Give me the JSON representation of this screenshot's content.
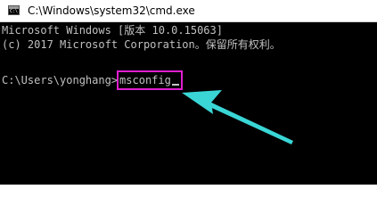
{
  "window": {
    "title": "C:\\Windows\\system32\\cmd.exe",
    "icon": "cmd-app-icon",
    "icon_glyph": "C:\\"
  },
  "console": {
    "line1": "Microsoft Windows [版本 10.0.15063]",
    "line2": "(c) 2017 Microsoft Corporation。保留所有权利。",
    "prompt": "C:\\Users\\yonghang>",
    "command": "msconfig"
  },
  "annotation": {
    "highlight_color": "#e01ed0",
    "arrow_color": "#3ad6d6"
  }
}
